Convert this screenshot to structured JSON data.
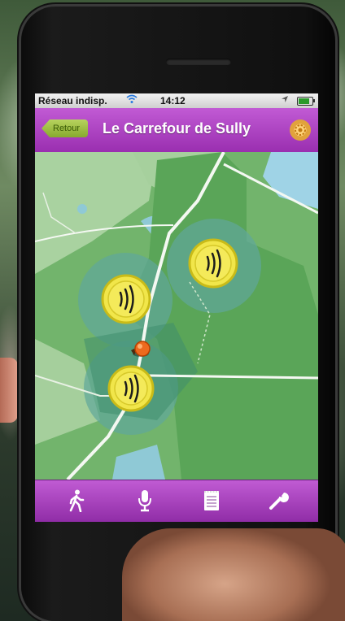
{
  "status_bar": {
    "carrier": "Réseau indisp.",
    "time": "14:12",
    "icons": [
      "wifi-icon",
      "location-arrow-icon",
      "battery-icon"
    ]
  },
  "nav_bar": {
    "back_label": "Retour",
    "title": "Le Carrefour de Sully",
    "right_icon": "gear-icon"
  },
  "map": {
    "markers": [
      {
        "kind": "audio",
        "icon": "sound-icon"
      },
      {
        "kind": "audio",
        "icon": "sound-icon"
      },
      {
        "kind": "audio",
        "icon": "sound-icon"
      },
      {
        "kind": "user-location",
        "icon": "location-pin-icon"
      }
    ]
  },
  "tab_bar": {
    "items": [
      {
        "name": "walk",
        "icon": "walking-person-icon"
      },
      {
        "name": "record",
        "icon": "microphone-icon"
      },
      {
        "name": "list",
        "icon": "notepad-icon"
      },
      {
        "name": "settings",
        "icon": "wrench-icon"
      }
    ]
  },
  "colors": {
    "accent_purple": "#a83bbd",
    "back_button_green": "#9bbd3f",
    "map_green": "#6fb06a",
    "marker_yellow": "#f1e64a"
  }
}
